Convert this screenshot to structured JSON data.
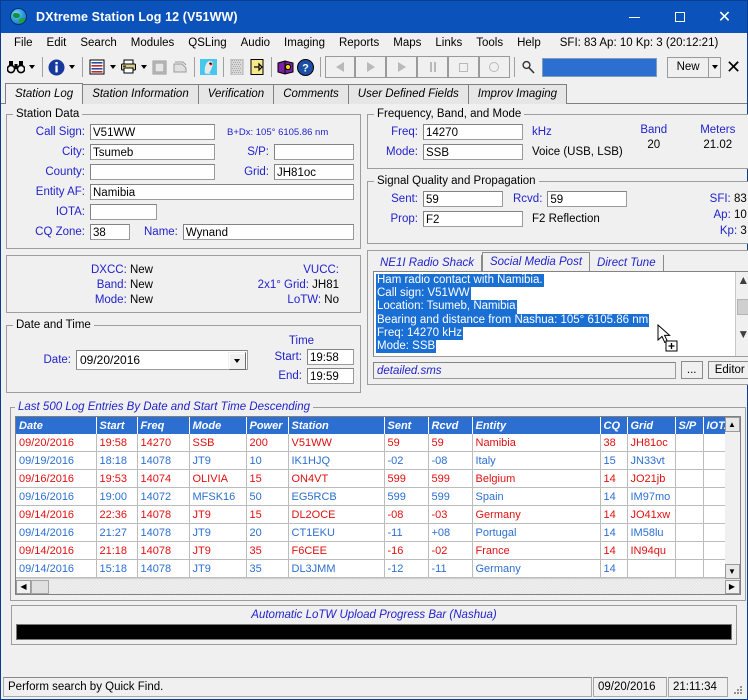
{
  "window": {
    "title": "DXtreme Station Log 12 (V51WW)",
    "icon": "globe-icon",
    "minimize": "–",
    "maximize": "□",
    "close": "✕"
  },
  "menubar": {
    "items": [
      "File",
      "Edit",
      "Search",
      "Modules",
      "QSLing",
      "Audio",
      "Imaging",
      "Reports",
      "Maps",
      "Links",
      "Tools",
      "Help"
    ],
    "solar": "SFI: 83 Ap: 10 Kp: 3 (20:12:21)"
  },
  "toolbar": {
    "quick_find_value": "",
    "new_label": "New",
    "close_label": "✕",
    "icons": [
      "binoculars-icon",
      "info-icon",
      "list-icon",
      "printer-icon",
      "page-icon",
      "copy-icon",
      "parrot-icon",
      "grid-icon",
      "export-icon",
      "book-icon",
      "help-icon"
    ],
    "nav_icons": [
      "first-record-icon",
      "previous-record-icon",
      "next-record-icon",
      "pause-icon",
      "stop-icon",
      "record-icon"
    ],
    "search_icon": "magnifier-icon"
  },
  "tabs": {
    "items": [
      "Station Log",
      "Station Information",
      "Verification",
      "Comments",
      "User Defined Fields",
      "Improv Imaging"
    ],
    "active": 0
  },
  "station_data": {
    "legend": "Station Data",
    "call_sign_label": "Call Sign:",
    "call_sign": "V51WW",
    "bdx": "B+Dx: 105° 6105.86 nm",
    "city_label": "City:",
    "city": "Tsumeb",
    "sp_label": "S/P:",
    "sp": "",
    "county_label": "County:",
    "county": "",
    "grid_label": "Grid:",
    "grid": "JH81oc",
    "entity_label": "Entity AF:",
    "entity": "Namibia",
    "iota_label": "IOTA:",
    "iota": "",
    "cq_zone_label": "CQ Zone:",
    "cq_zone": "38",
    "name_label": "Name:",
    "name": "Wynand",
    "dxcc_label": "DXCC:",
    "dxcc": "New",
    "band_label": "Band:",
    "band": "New",
    "mode_label": "Mode:",
    "mode": "New",
    "vucc_label": "VUCC:",
    "vucc": "",
    "grid2x1_label": "2x1° Grid:",
    "grid2x1": "JH81",
    "lotw_label": "LoTW:",
    "lotw": "No"
  },
  "date_time": {
    "legend": "Date and Time",
    "date_label": "Date:",
    "date": "09/20/2016",
    "time_header": "Time",
    "start_label": "Start:",
    "start": "19:58",
    "end_label": "End:",
    "end": "19:59"
  },
  "frequency": {
    "legend": "Frequency, Band, and Mode",
    "freq_label": "Freq:",
    "freq": "14270",
    "khz_label": "kHz",
    "band_header": "Band",
    "band_value": "20",
    "meters_header": "Meters",
    "meters_value": "21.02",
    "mode_label": "Mode:",
    "mode": "SSB",
    "mode_desc": "Voice (USB, LSB)"
  },
  "signal": {
    "legend": "Signal Quality and Propagation",
    "sent_label": "Sent:",
    "sent": "59",
    "rcvd_label": "Rcvd:",
    "rcvd": "59",
    "prop_label": "Prop:",
    "prop": "F2",
    "prop_desc": "F2 Reflection",
    "sfi_label": "SFI:",
    "sfi": "83",
    "ap_label": "Ap:",
    "ap": "10",
    "kp_label": "Kp:",
    "kp": "3"
  },
  "social": {
    "tabs": [
      "NE1I Radio Shack",
      "Social Media Post",
      "Direct Tune"
    ],
    "active": 1,
    "lines": [
      "Ham radio contact with Namibia.",
      "Call sign: V51WW",
      "Location: Tsumeb, Namibia",
      "Bearing and distance from Nashua: 105° 6105.86 nm",
      "Freq: 14270 kHz",
      "Mode: SSB"
    ],
    "file": "detailed.sms",
    "browse_label": "...",
    "editor_label": "Editor",
    "scroll_up_icon": "chevron-up-icon",
    "scroll_down_icon": "chevron-down-icon"
  },
  "log": {
    "legend": "Last 500 Log Entries By Date and Start Time Descending",
    "columns": [
      "Date",
      "Start",
      "Freq",
      "Mode",
      "Power",
      "Station",
      "Sent",
      "Rcvd",
      "Entity",
      "CQ",
      "Grid",
      "S/P",
      "IOTA"
    ],
    "rows": [
      [
        "09/20/2016",
        "19:58",
        "14270",
        "SSB",
        "200",
        "V51WW",
        "59",
        "59",
        "Namibia",
        "38",
        "JH81oc",
        "",
        ""
      ],
      [
        "09/19/2016",
        "18:18",
        "14078",
        "JT9",
        "10",
        "IK1HJQ",
        "-02",
        "-08",
        "Italy",
        "15",
        "JN33vt",
        "",
        ""
      ],
      [
        "09/16/2016",
        "19:53",
        "14074",
        "OLIVIA",
        "15",
        "ON4VT",
        "599",
        "599",
        "Belgium",
        "14",
        "JO21jb",
        "",
        ""
      ],
      [
        "09/16/2016",
        "19:00",
        "14072",
        "MFSK16",
        "50",
        "EG5RCB",
        "599",
        "599",
        "Spain",
        "14",
        "IM97mo",
        "",
        ""
      ],
      [
        "09/14/2016",
        "22:36",
        "14078",
        "JT9",
        "15",
        "DL2OCE",
        "-08",
        "-03",
        "Germany",
        "14",
        "JO41xw",
        "",
        ""
      ],
      [
        "09/14/2016",
        "21:27",
        "14078",
        "JT9",
        "20",
        "CT1EKU",
        "-11",
        "+08",
        "Portugal",
        "14",
        "IM58lu",
        "",
        ""
      ],
      [
        "09/14/2016",
        "21:18",
        "14078",
        "JT9",
        "35",
        "F6CEE",
        "-16",
        "-02",
        "France",
        "14",
        "IN94qu",
        "",
        ""
      ],
      [
        "09/14/2016",
        "15:18",
        "14078",
        "JT9",
        "35",
        "DL3JMM",
        "-12",
        "-11",
        "Germany",
        "14",
        "",
        "",
        ""
      ]
    ]
  },
  "progress": {
    "title": "Automatic LoTW Upload Progress Bar (Nashua)",
    "percent": 0
  },
  "statusbar": {
    "message": "Perform search by Quick Find.",
    "date": "09/20/2016",
    "time": "21:11:34"
  },
  "colors": {
    "titlebar": "#0b52ba",
    "accent_blue": "#2222cc",
    "header_blue": "#2c6fd1",
    "row_red": "#e01010",
    "row_blue": "#2c6fd1",
    "selection": "#1a6fd4"
  }
}
